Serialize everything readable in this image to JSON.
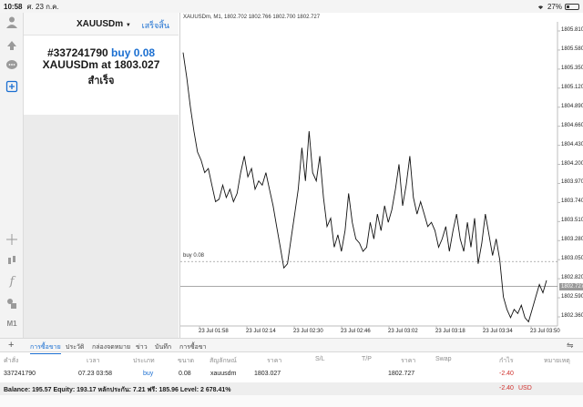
{
  "status_bar": {
    "time": "10:58",
    "date": "ศ. 23 ก.ค.",
    "battery": "27%"
  },
  "order_panel": {
    "symbol": "XAUUSDm",
    "done_label": "เสร็จสิ้น",
    "ticket": "#337241790",
    "direction": "buy 0.08",
    "symbol_at": "XAUUSDm at",
    "price": "1803.027",
    "status": "สำเร็จ"
  },
  "sidebar": {
    "icons": [
      "person-icon",
      "trade-arrows-icon",
      "chat-icon",
      "new-order-icon",
      "crosshair-icon",
      "indicator-icon",
      "function-icon",
      "objects-icon"
    ],
    "timeframe": "M1"
  },
  "chart": {
    "header": "XAUUSDm, M1, 1802.702 1802.766 1802.700 1802.727",
    "buy_line_label": "buy 0.08",
    "current_price_label": "1802.727",
    "y_ticks": [
      "1805.810",
      "1805.580",
      "1805.350",
      "1805.120",
      "1804.890",
      "1804.660",
      "1804.430",
      "1804.200",
      "1803.970",
      "1803.740",
      "1803.510",
      "1803.280",
      "1803.050",
      "1802.820",
      "1802.590",
      "1802.360"
    ],
    "x_ticks": [
      "23 Jul 01:58",
      "23 Jul 02:14",
      "23 Jul 02:30",
      "23 Jul 02:46",
      "23 Jul 03:02",
      "23 Jul 03:18",
      "23 Jul 03:34",
      "23 Jul 03:50"
    ]
  },
  "chart_data": {
    "type": "line",
    "title": "",
    "y_range": [
      1802.25,
      1805.92
    ],
    "buy_level": 1803.027,
    "current_price": 1802.727,
    "values": [
      1805.55,
      1805.25,
      1804.9,
      1804.6,
      1804.35,
      1804.25,
      1804.1,
      1804.15,
      1803.95,
      1803.75,
      1803.78,
      1803.95,
      1803.8,
      1803.9,
      1803.75,
      1803.85,
      1804.1,
      1804.3,
      1804.05,
      1804.15,
      1803.9,
      1804.0,
      1803.95,
      1804.1,
      1803.9,
      1803.7,
      1803.45,
      1803.2,
      1802.95,
      1803.0,
      1803.3,
      1803.6,
      1803.9,
      1804.4,
      1804.0,
      1804.6,
      1804.1,
      1804.0,
      1804.3,
      1803.8,
      1803.45,
      1803.55,
      1803.2,
      1803.35,
      1803.15,
      1803.4,
      1803.85,
      1803.5,
      1803.3,
      1803.25,
      1803.15,
      1803.2,
      1803.5,
      1803.3,
      1803.6,
      1803.4,
      1803.7,
      1803.5,
      1803.65,
      1803.9,
      1804.2,
      1803.7,
      1803.95,
      1804.3,
      1803.8,
      1803.6,
      1803.75,
      1803.6,
      1803.45,
      1803.5,
      1803.4,
      1803.2,
      1803.3,
      1803.45,
      1803.15,
      1803.4,
      1803.6,
      1803.3,
      1803.15,
      1803.5,
      1803.2,
      1803.55,
      1803.0,
      1803.25,
      1803.6,
      1803.35,
      1803.1,
      1803.3,
      1803.05,
      1802.6,
      1802.45,
      1802.35,
      1802.45,
      1802.4,
      1802.5,
      1802.35,
      1802.3,
      1802.45,
      1802.6,
      1802.75,
      1802.65,
      1802.8
    ]
  },
  "tabs": [
    {
      "label": "การซื้อขาย",
      "active": true
    },
    {
      "label": "ประวัติ",
      "active": false
    },
    {
      "label": "กล่องจดหมาย",
      "active": false
    },
    {
      "label": "ข่าว",
      "active": false
    },
    {
      "label": "บันทึก",
      "active": false
    },
    {
      "label": "การซื้อขา",
      "active": false
    }
  ],
  "table": {
    "headers": [
      "คำสั่ง",
      "เวลา",
      "ประเภท",
      "ขนาด",
      "สัญลักษณ์",
      "ราคา",
      "S/L",
      "T/P",
      "ราคา",
      "Swap",
      "กำไร",
      "หมายเหตุ"
    ],
    "row": [
      "337241790",
      "07.23 03:58",
      "buy",
      "0.08",
      "xauusdm",
      "1803.027",
      "",
      "",
      "1802.727",
      "",
      "-2.40",
      ""
    ]
  },
  "balance": {
    "text": "Balance: 195.57  Equity: 193.17  หลักประกัน: 7.21  ฟรี: 185.96  Level: 2 678.41%",
    "profit": "-2.40",
    "currency": "USD"
  },
  "colors": {
    "accent": "#1b6fd1",
    "loss": "#d0312d"
  }
}
